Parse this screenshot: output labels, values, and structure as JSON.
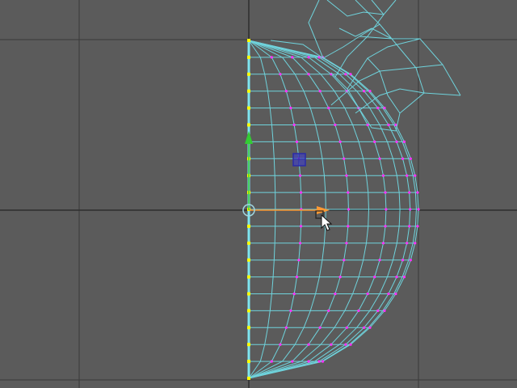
{
  "viewport": {
    "background": "#5b5b5b",
    "grid_color": "#3a3a3a",
    "axis_color": "#2e2e2e",
    "wire_color": "#6fd3dc",
    "vertex_color": "#ff33ff",
    "seam_color": "#ffff00",
    "seam_edge_color": "#7fe6f0"
  },
  "gizmo": {
    "x_axis_color": "#ff9933",
    "y_axis_color": "#33cc33",
    "origin_color": "#9fd6e0",
    "pivot_color": "#3333cc"
  },
  "cursor": {
    "icon": "move-cursor-icon"
  }
}
